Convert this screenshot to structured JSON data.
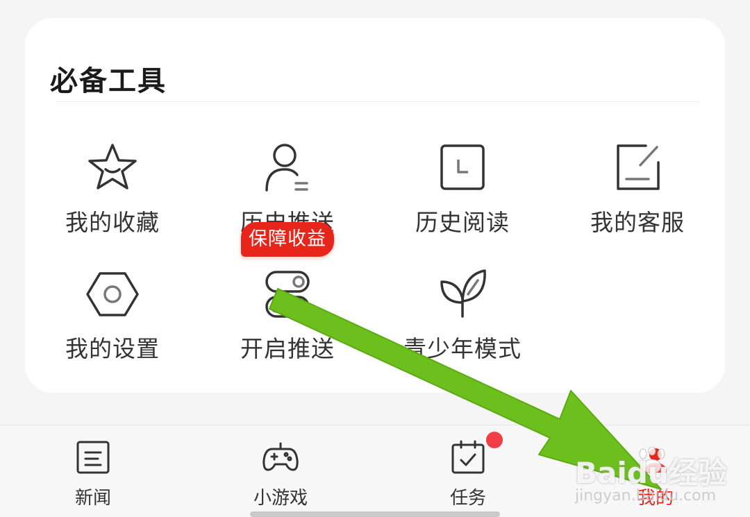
{
  "section": {
    "title": "必备工具"
  },
  "tools": [
    {
      "label": "我的收藏",
      "icon": "star-icon"
    },
    {
      "label": "历史推送",
      "icon": "user-history-icon"
    },
    {
      "label": "历史阅读",
      "icon": "reading-history-icon"
    },
    {
      "label": "我的客服",
      "icon": "edit-service-icon"
    },
    {
      "label": "我的设置",
      "icon": "settings-hexagon-icon"
    },
    {
      "label": "开启推送",
      "icon": "toggle-push-icon"
    },
    {
      "label": "青少年模式",
      "icon": "leaf-icon"
    }
  ],
  "badge": {
    "text": "保障收益",
    "color": "#e8251b"
  },
  "tabbar": {
    "tabs": [
      {
        "label": "新闻",
        "icon": "news-icon"
      },
      {
        "label": "小游戏",
        "icon": "gamepad-icon"
      },
      {
        "label": "任务",
        "icon": "task-icon",
        "has_dot": true
      },
      {
        "label": "我的",
        "icon": "profile-icon",
        "active": true
      }
    ]
  },
  "annotation": {
    "arrow_color": "#6cbf1c"
  },
  "watermark": {
    "main": "Baidu经验",
    "sub": "jingyan.baidu.com"
  }
}
